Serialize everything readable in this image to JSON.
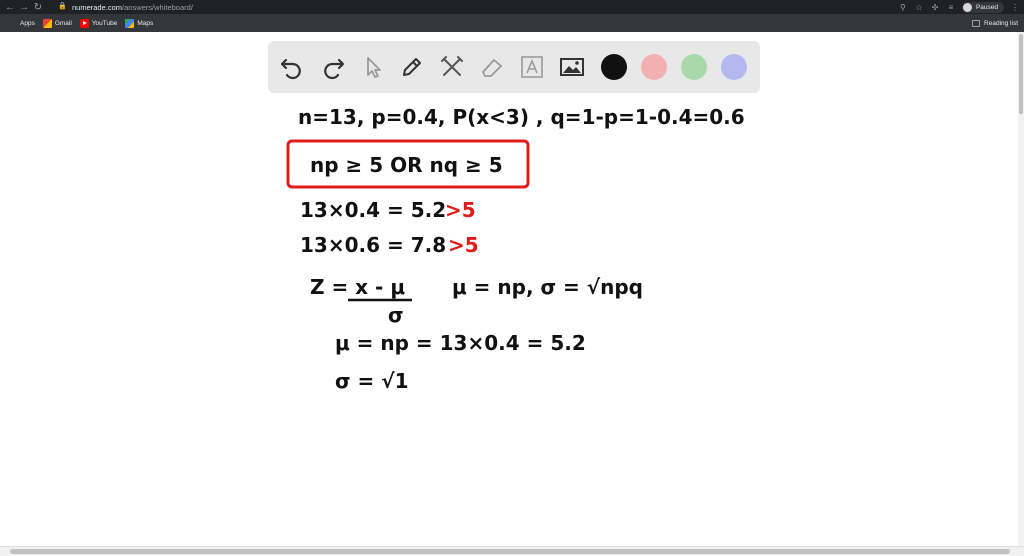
{
  "browser": {
    "url_host": "numerade.com",
    "url_path": "/answers/whiteboard/",
    "profile_status": "Paused",
    "bookmarks": [
      {
        "label": "Apps",
        "icon": "apps-grid-icon"
      },
      {
        "label": "Gmail",
        "icon": "gmail-icon"
      },
      {
        "label": "YouTube",
        "icon": "youtube-icon"
      },
      {
        "label": "Maps",
        "icon": "maps-icon"
      }
    ],
    "reading_list": "Reading list"
  },
  "toolbar": {
    "tools": [
      "undo-icon",
      "redo-icon",
      "select-cursor-icon",
      "pen-icon",
      "tools-icon",
      "eraser-icon",
      "text-icon",
      "image-icon"
    ],
    "colors": [
      "#111111",
      "#f2b1b1",
      "#a9d8ab",
      "#b3b8ef"
    ]
  },
  "whiteboard": {
    "line1": "n=13,  p=0.4,  P(x<3) , q=1-p=1-0.4=0.6",
    "boxed": "np ≥ 5   OR   nq ≥ 5",
    "line3": "13×0.4 = 5.2",
    "line3_red": ">5",
    "line4": "13×0.6 = 7.8",
    "line4_red": ">5",
    "line5_z": "Z = x - μ",
    "line5_sigma": "σ",
    "line5_rest": "μ = np,  σ = √npq",
    "line6": "μ = np = 13×0.4 = 5.2",
    "line7": "σ = √1"
  },
  "annotation": {
    "box_color": "#e01b1b"
  }
}
